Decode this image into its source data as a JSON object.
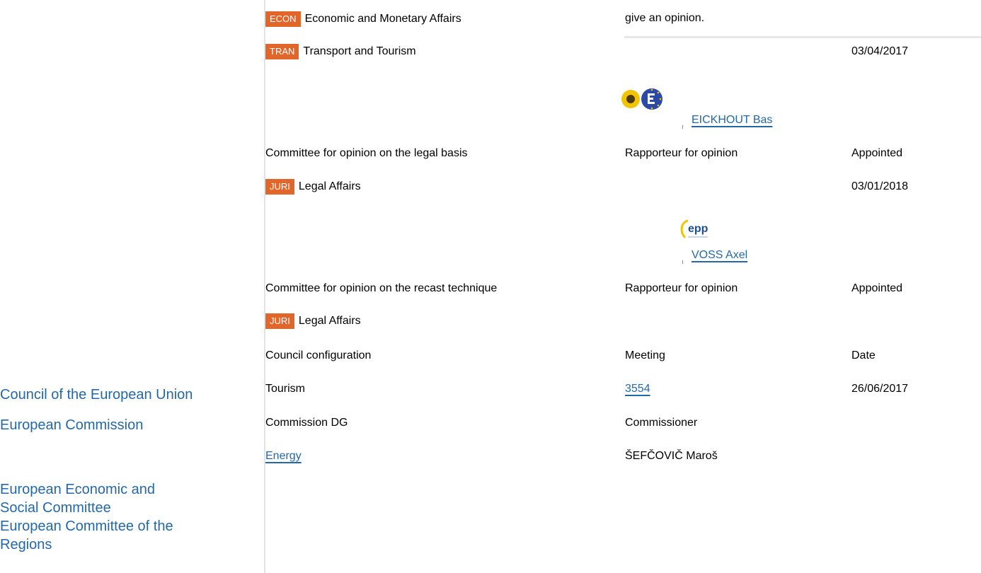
{
  "sidebar": {
    "items": [
      {
        "label": "Council of the European Union"
      },
      {
        "label": "European Commission"
      },
      {
        "label": "European Economic and"
      },
      {
        "label": "Social Committee"
      },
      {
        "label": "European Committee of the"
      },
      {
        "label": "Regions"
      }
    ]
  },
  "top": {
    "econ_code": "ECON",
    "econ_name": "Economic and Monetary Affairs",
    "econ_note": "give an opinion."
  },
  "tran": {
    "code": "TRAN",
    "name": "Transport and Tourism",
    "date": "03/04/2017",
    "rapporteur": "EICKHOUT Bas"
  },
  "legal_basis": {
    "heading": "Committee for opinion on the legal basis",
    "col2": "Rapporteur for opinion",
    "col3": "Appointed",
    "code": "JURI",
    "name": "Legal Affairs",
    "date": "03/01/2018",
    "rapporteur": "VOSS Axel",
    "logo_text": "epp"
  },
  "recast": {
    "heading": "Committee for opinion on the recast technique",
    "col2": "Rapporteur for opinion",
    "col3": "Appointed",
    "code": "JURI",
    "name": "Legal Affairs"
  },
  "council": {
    "h1": "Council configuration",
    "h2": "Meeting",
    "h3": "Date",
    "config": "Tourism",
    "meeting": "3554",
    "date": "26/06/2017"
  },
  "commission": {
    "h1": "Commission DG",
    "h2": "Commissioner",
    "dg": "Energy",
    "commissioner": "ŠEFČOVIČ Maroš"
  },
  "colors": {
    "link": "#2568a8",
    "badge": "#e2662a",
    "border": "#e3e3e3"
  }
}
